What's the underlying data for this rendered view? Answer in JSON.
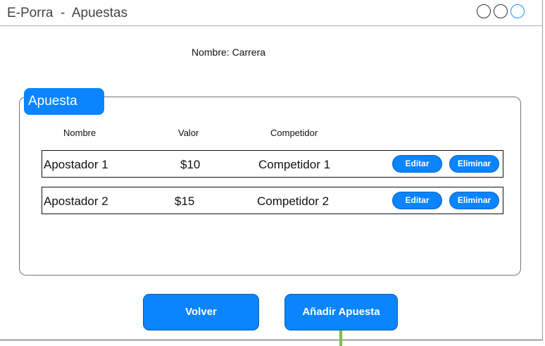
{
  "window": {
    "title": "E-Porra  -  Apuestas",
    "controls": [
      "circle-button",
      "circle-button",
      "circle-button-active"
    ],
    "accent_color": "#0a84ff"
  },
  "race": {
    "label": "Nombre:",
    "value": "Carrera"
  },
  "bets_group": {
    "title": "Apuesta",
    "columns": [
      "Nombre",
      "Valor",
      "Competidor"
    ],
    "rows": [
      {
        "name": "Apostador 1",
        "value": "$10",
        "competitor": "Competidor 1",
        "edit_label": "Editar",
        "delete_label": "Eliminar"
      },
      {
        "name": "Apostador 2",
        "value": "$15",
        "competitor": "Competidor 2",
        "edit_label": "Editar",
        "delete_label": "Eliminar"
      }
    ]
  },
  "actions": {
    "back_label": "Volver",
    "add_label": "Añadir Apuesta"
  }
}
